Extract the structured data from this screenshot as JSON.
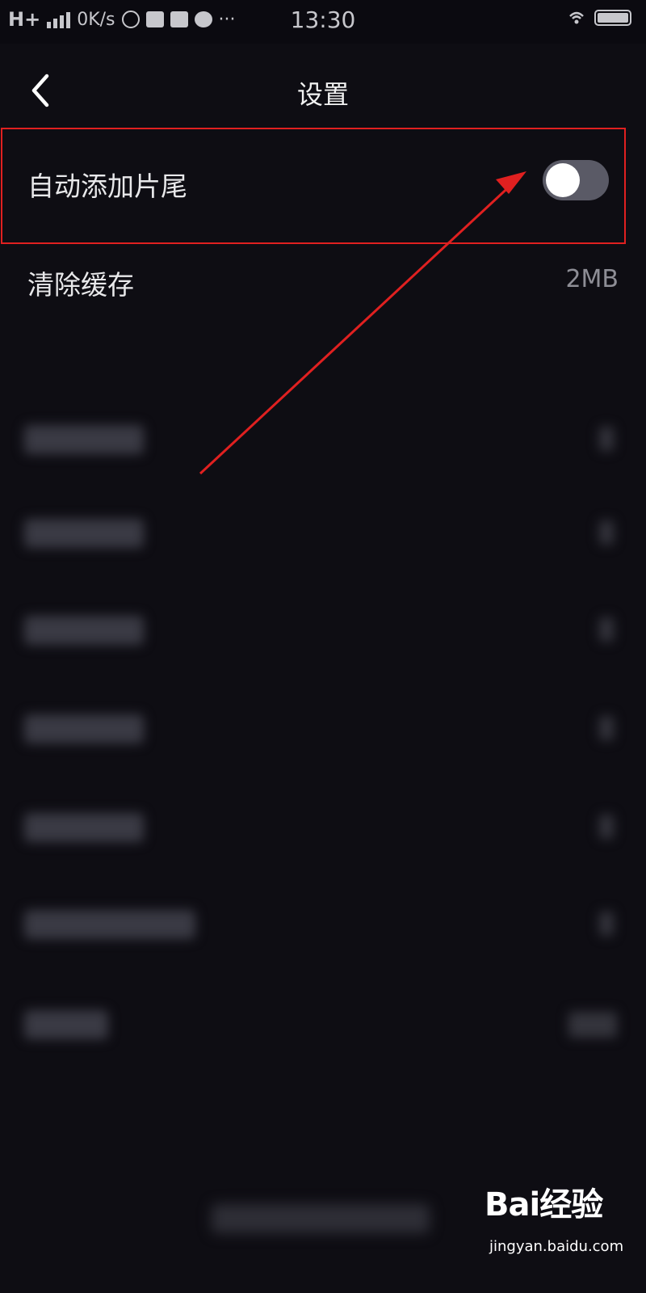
{
  "status_bar": {
    "network": "H+",
    "speed": "0K/s",
    "time": "13:30"
  },
  "header": {
    "title": "设置",
    "back_icon": "chevron-left-icon"
  },
  "settings": {
    "auto_outro": {
      "label": "自动添加片尾",
      "enabled": false
    },
    "clear_cache": {
      "label": "清除缓存",
      "value": "2MB"
    }
  },
  "annotation": {
    "color": "#e02020"
  },
  "watermark": {
    "brand": "Bai经验",
    "url": "jingyan.baidu.com"
  }
}
